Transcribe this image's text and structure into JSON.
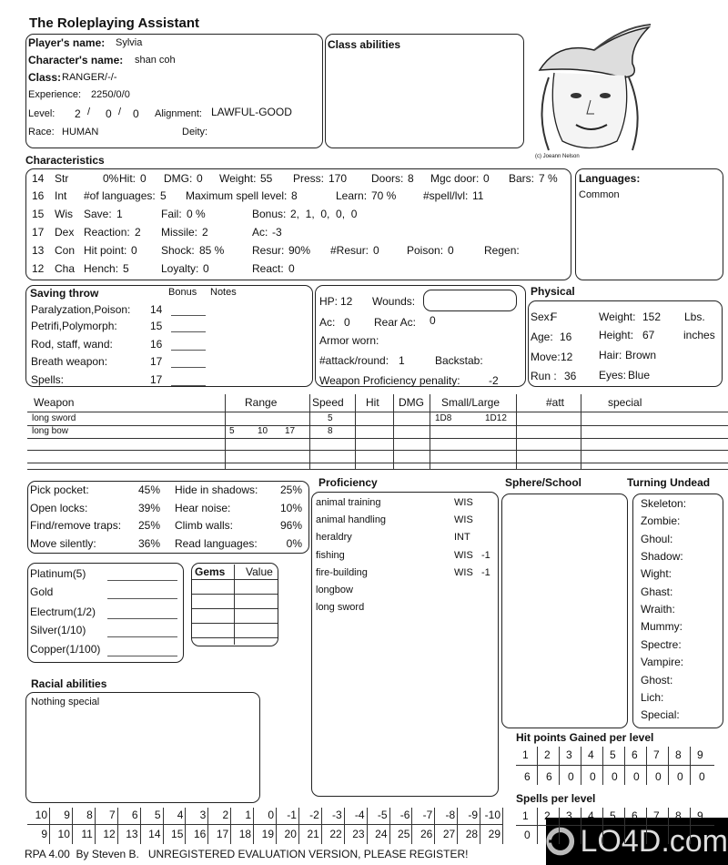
{
  "title": "The Roleplaying Assistant",
  "player": {
    "player_label": "Player's name:",
    "player_value": "Sylvia",
    "char_label": "Character's name:",
    "char_value": "shan coh",
    "class_label": "Class:",
    "class_value": "RANGER/-/-",
    "exp_label": "Experience:",
    "exp_value": "2250/0/0",
    "level_label": "Level:",
    "level_values": [
      "2",
      "0",
      "0"
    ],
    "align_label": "Alignment:",
    "align_value": "LAWFUL-GOOD",
    "race_label": "Race:",
    "race_value": "HUMAN",
    "deity_label": "Deity:",
    "deity_value": ""
  },
  "class_abilities": {
    "label": "Class abilities"
  },
  "portrait": {
    "credit": "(c) Joeann Nelson"
  },
  "characteristics": {
    "label": "Characteristics",
    "rows": [
      {
        "score": "14",
        "abbr": "Str",
        "fields": [
          {
            "label": "",
            "value": "0%"
          },
          {
            "label": "Hit:",
            "value": "0"
          },
          {
            "label": "DMG:",
            "value": "0"
          },
          {
            "label": "Weight:",
            "value": "55"
          },
          {
            "label": "Press:",
            "value": "170"
          },
          {
            "label": "Doors:",
            "value": "8"
          },
          {
            "label": "Mgc door:",
            "value": "0"
          },
          {
            "label": "Bars:",
            "value": "7 %"
          }
        ]
      },
      {
        "score": "16",
        "abbr": "Int",
        "fields": [
          {
            "label": "#of languages:",
            "value": "5"
          },
          {
            "label": "Maximum spell level:",
            "value": "8"
          },
          {
            "label": "Learn:",
            "value": "70 %"
          },
          {
            "label": "#spell/lvl:",
            "value": "11"
          }
        ]
      },
      {
        "score": "15",
        "abbr": "Wis",
        "fields": [
          {
            "label": "Save:",
            "value": "1"
          },
          {
            "label": "Fail:",
            "value": "0 %"
          },
          {
            "label": "Bonus:",
            "value": "2,  1,  0,  0,  0"
          }
        ]
      },
      {
        "score": "17",
        "abbr": "Dex",
        "fields": [
          {
            "label": "Reaction:",
            "value": "2"
          },
          {
            "label": "Missile:",
            "value": "2"
          },
          {
            "label": "Ac:",
            "value": "-3"
          }
        ]
      },
      {
        "score": "13",
        "abbr": "Con",
        "fields": [
          {
            "label": "Hit point:",
            "value": "0"
          },
          {
            "label": "Shock:",
            "value": "85 %"
          },
          {
            "label": "Resur:",
            "value": "90%"
          },
          {
            "label": "#Resur:",
            "value": "0"
          },
          {
            "label": "Poison:",
            "value": "0"
          },
          {
            "label": "Regen:",
            "value": ""
          }
        ]
      },
      {
        "score": "12",
        "abbr": "Cha",
        "fields": [
          {
            "label": "Hench:",
            "value": "5"
          },
          {
            "label": "Loyalty:",
            "value": "0"
          },
          {
            "label": "React:",
            "value": "0"
          }
        ]
      }
    ]
  },
  "languages": {
    "label": "Languages:",
    "items": [
      "Common"
    ]
  },
  "saving_throw": {
    "label": "Saving throw",
    "bonus_label": "Bonus",
    "notes_label": "Notes",
    "rows": [
      {
        "label": "Paralyzation,Poison:",
        "value": "14"
      },
      {
        "label": "Petrifi,Polymorph:",
        "value": "15"
      },
      {
        "label": "Rod, staff, wand:",
        "value": "16"
      },
      {
        "label": "Breath weapon:",
        "value": "17"
      },
      {
        "label": "Spells:",
        "value": "17"
      }
    ]
  },
  "combat": {
    "hp_label": "HP:",
    "hp_value": "12",
    "wounds_label": "Wounds:",
    "wounds_value": "",
    "ac_label": "Ac:",
    "ac_value": "0",
    "rear_ac_label": "Rear Ac:",
    "rear_ac_value": "0",
    "armor_label": "Armor worn:",
    "armor_value": "",
    "attacks_label": "#attack/round:",
    "attacks_value": "1",
    "backstab_label": "Backstab:",
    "backstab_value": "",
    "penalty_label": "Weapon Proficiency penality:",
    "penalty_value": "-2"
  },
  "physical": {
    "label": "Physical",
    "sex_label": "Sex:",
    "sex_value": "F",
    "age_label": "Age:",
    "age_value": "16",
    "move_label": "Move:",
    "move_value": "12",
    "run_label": "Run :",
    "run_value": "36",
    "weight_label": "Weight:",
    "weight_value": "152",
    "weight_unit": "Lbs.",
    "height_label": "Height:",
    "height_value": "67",
    "height_unit": "inches",
    "hair_label": "Hair:",
    "hair_value": "Brown",
    "eyes_label": "Eyes:",
    "eyes_value": "Blue"
  },
  "weapons": {
    "headers": [
      "Weapon",
      "Range",
      "Speed",
      "Hit",
      "DMG",
      "Small/Large",
      "#att",
      "special"
    ],
    "rows": [
      {
        "name": "long sword",
        "range": [
          "",
          "",
          ""
        ],
        "speed": "5",
        "hit": "",
        "dmg": "",
        "small": "1D8",
        "large": "1D12",
        "att": "",
        "special": ""
      },
      {
        "name": "long bow",
        "range": [
          "5",
          "10",
          "17"
        ],
        "speed": "8",
        "hit": "",
        "dmg": "",
        "small": "",
        "large": "",
        "att": "",
        "special": ""
      }
    ]
  },
  "thief_skills": [
    {
      "label": "Pick pocket:",
      "value": "45%"
    },
    {
      "label": "Hide in shadows:",
      "value": "25%"
    },
    {
      "label": "Open locks:",
      "value": "39%"
    },
    {
      "label": "Hear noise:",
      "value": "10%"
    },
    {
      "label": "Find/remove traps:",
      "value": "25%"
    },
    {
      "label": "Climb walls:",
      "value": "96%"
    },
    {
      "label": "Move silently:",
      "value": "36%"
    },
    {
      "label": "Read languages:",
      "value": "0%"
    }
  ],
  "proficiency": {
    "label": "Proficiency",
    "items": [
      {
        "name": "animal training",
        "attr": "WIS",
        "mod": ""
      },
      {
        "name": "animal handling",
        "attr": "WIS",
        "mod": ""
      },
      {
        "name": "heraldry",
        "attr": "INT",
        "mod": ""
      },
      {
        "name": "fishing",
        "attr": "WIS",
        "mod": "-1"
      },
      {
        "name": "fire-building",
        "attr": "WIS",
        "mod": "-1"
      },
      {
        "name": "longbow",
        "attr": "",
        "mod": ""
      },
      {
        "name": "long sword",
        "attr": "",
        "mod": ""
      }
    ]
  },
  "sphere_school": {
    "label": "Sphere/School"
  },
  "turning_undead": {
    "label": "Turning Undead",
    "items": [
      "Skeleton:",
      "Zombie:",
      "Ghoul:",
      "Shadow:",
      "Wight:",
      "Ghast:",
      "Wraith:",
      "Mummy:",
      "Spectre:",
      "Vampire:",
      "Ghost:",
      "Lich:",
      "Special:"
    ]
  },
  "money": [
    "Platinum(5)",
    "Gold",
    "Electrum(1/2)",
    "Silver(1/10)",
    "Copper(1/100)"
  ],
  "gems": {
    "label": "Gems",
    "value_label": "Value"
  },
  "racial_abilities": {
    "label": "Racial abilities",
    "value": "Nothing special"
  },
  "hit_points_per_level": {
    "label": "Hit points Gained per level",
    "levels": [
      "1",
      "2",
      "3",
      "4",
      "5",
      "6",
      "7",
      "8",
      "9"
    ],
    "values": [
      "6",
      "6",
      "0",
      "0",
      "0",
      "0",
      "0",
      "0",
      "0"
    ]
  },
  "spells_per_level": {
    "label": "Spells per level",
    "levels": [
      "1",
      "2",
      "3",
      "4",
      "5",
      "6",
      "7",
      "8",
      "9"
    ],
    "values": [
      "0"
    ]
  },
  "thac0_table": {
    "ac": [
      "10",
      "9",
      "8",
      "7",
      "6",
      "5",
      "4",
      "3",
      "2",
      "1",
      "0",
      "-1",
      "-2",
      "-3",
      "-4",
      "-5",
      "-6",
      "-7",
      "-8",
      "-9",
      "-10"
    ],
    "roll": [
      "9",
      "10",
      "11",
      "12",
      "13",
      "14",
      "15",
      "16",
      "17",
      "18",
      "19",
      "20",
      "21",
      "22",
      "23",
      "24",
      "25",
      "26",
      "27",
      "28",
      "29"
    ]
  },
  "footer": "RPA 4.00  By Steven B.   UNREGISTERED EVALUATION VERSION, PLEASE REGISTER!",
  "watermark": "LO4D.com"
}
